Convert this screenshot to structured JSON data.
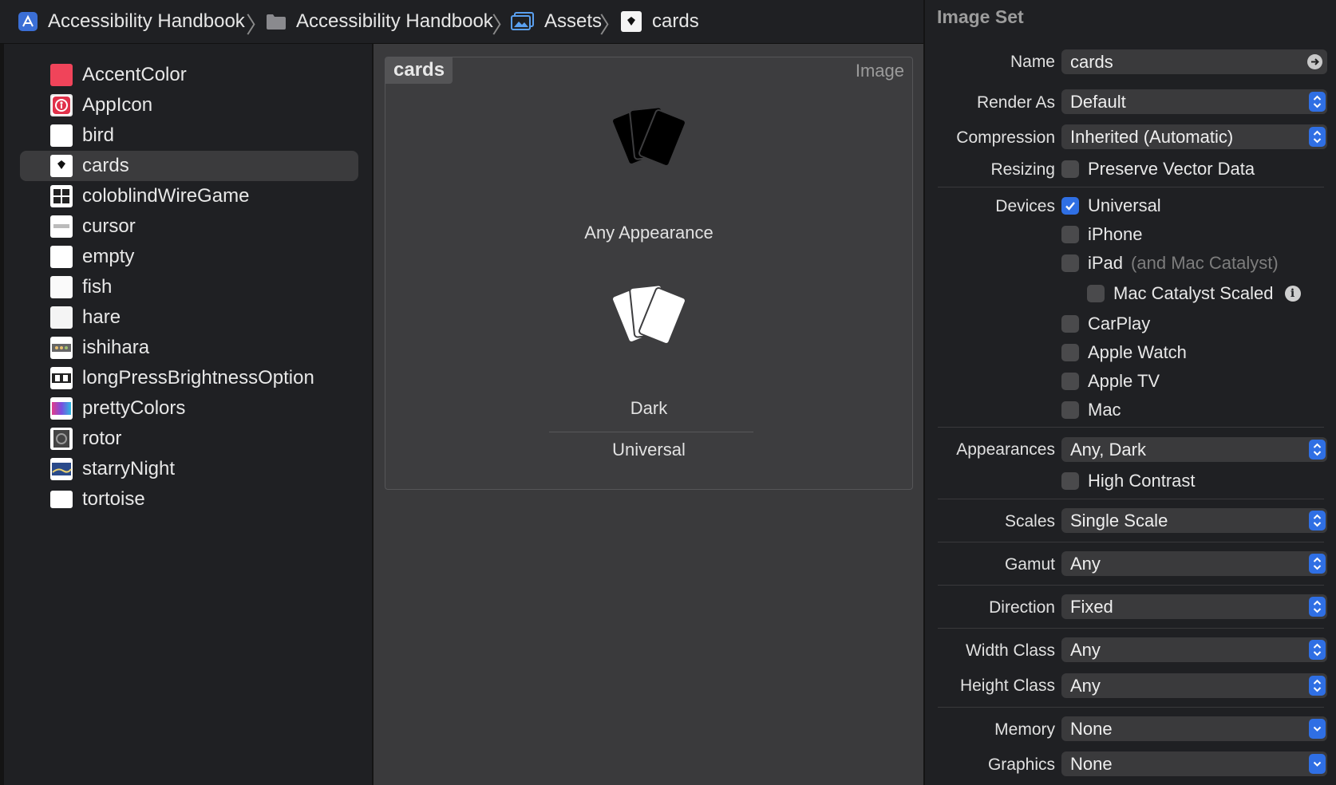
{
  "breadcrumb": [
    {
      "label": "Accessibility Handbook",
      "icon": "app-project-icon"
    },
    {
      "label": "Accessibility Handbook",
      "icon": "folder-icon"
    },
    {
      "label": "Assets",
      "icon": "asset-catalog-icon"
    },
    {
      "label": "cards",
      "icon": "image-set-icon"
    }
  ],
  "navigator": {
    "items": [
      {
        "label": "AccentColor",
        "kind": "color",
        "color": "#f0445a"
      },
      {
        "label": "AppIcon",
        "kind": "appicon"
      },
      {
        "label": "bird"
      },
      {
        "label": "cards",
        "selected": true
      },
      {
        "label": "coloblindWireGame"
      },
      {
        "label": "cursor"
      },
      {
        "label": "empty"
      },
      {
        "label": "fish"
      },
      {
        "label": "hare"
      },
      {
        "label": "ishihara"
      },
      {
        "label": "longPressBrightnessOption"
      },
      {
        "label": "prettyColors"
      },
      {
        "label": "rotor"
      },
      {
        "label": "starryNight"
      },
      {
        "label": "tortoise"
      }
    ]
  },
  "editor": {
    "set_name": "cards",
    "set_kind": "Image",
    "slot_any": "Any Appearance",
    "slot_dark": "Dark",
    "idiom": "Universal"
  },
  "inspector": {
    "title": "Image Set",
    "name_label": "Name",
    "name_value": "cards",
    "render_as_label": "Render As",
    "render_as_value": "Default",
    "compression_label": "Compression",
    "compression_value": "Inherited (Automatic)",
    "resizing_label": "Resizing",
    "preserve_vector": "Preserve Vector Data",
    "devices_label": "Devices",
    "devices": {
      "universal": "Universal",
      "iphone": "iPhone",
      "ipad": "iPad",
      "ipad_note": "(and Mac Catalyst)",
      "mac_catalyst_scaled": "Mac Catalyst Scaled",
      "carplay": "CarPlay",
      "apple_watch": "Apple Watch",
      "apple_tv": "Apple TV",
      "mac": "Mac"
    },
    "appearances_label": "Appearances",
    "appearances_value": "Any, Dark",
    "high_contrast": "High Contrast",
    "scales_label": "Scales",
    "scales_value": "Single Scale",
    "gamut_label": "Gamut",
    "gamut_value": "Any",
    "direction_label": "Direction",
    "direction_value": "Fixed",
    "width_class_label": "Width Class",
    "width_class_value": "Any",
    "height_class_label": "Height Class",
    "height_class_value": "Any",
    "memory_label": "Memory",
    "memory_value": "None",
    "graphics_label": "Graphics",
    "graphics_value": "None"
  },
  "colors": {
    "accent": "#2f6fe4",
    "selection": "#3b3b3d",
    "accent_color_swatch": "#f0445a"
  }
}
